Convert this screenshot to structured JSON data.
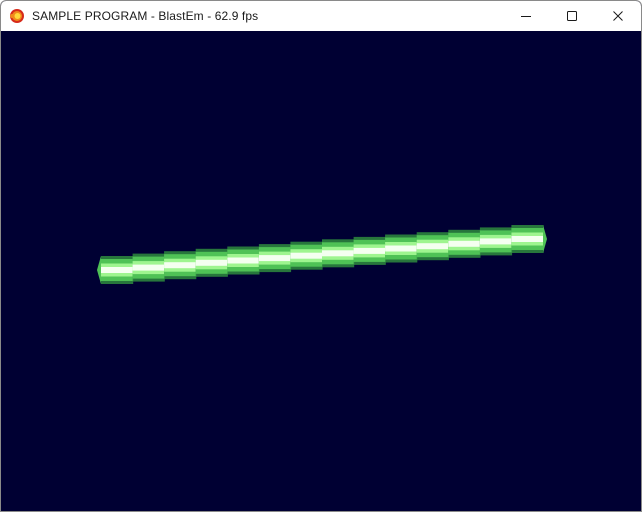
{
  "window": {
    "title": "SAMPLE PROGRAM - BlastEm - 62.9 fps",
    "app_icon": "blastem-icon",
    "controls": [
      {
        "name": "minimize",
        "icon": "minimize-icon"
      },
      {
        "name": "maximize",
        "icon": "maximize-icon"
      },
      {
        "name": "close",
        "icon": "close-icon"
      }
    ]
  },
  "display": {
    "background_color": "#000033",
    "beam_colors": {
      "outer": "#2e8b3e",
      "mid": "#4fc256",
      "inner": "#9ef58f",
      "core": "#f4fff0"
    }
  }
}
